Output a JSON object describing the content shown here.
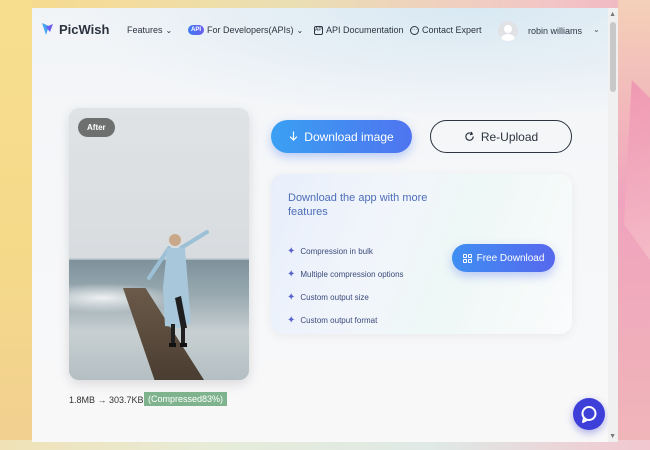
{
  "nav": {
    "logo_text": "PicWish",
    "features_label": "Features",
    "api_badge": "API",
    "developers_label": "For Developers(APIs)",
    "api_docs_icon_text": "API",
    "api_docs_label": "API Documentation",
    "contact_label": "Contact Expert",
    "user_name": "robin williams"
  },
  "preview": {
    "badge": "After"
  },
  "result": {
    "size_text": "1.8MB → 303.7KB",
    "compressed_badge": "(Compressed83%)"
  },
  "actions": {
    "download_label": "Download image",
    "reupload_label": "Re-Upload"
  },
  "promo": {
    "title": "Download the app with more features",
    "features": [
      "Compression in bulk",
      "Multiple compression options",
      "Custom output size",
      "Custom output format"
    ],
    "free_download_label": "Free Download"
  },
  "colors": {
    "accent_blue": "#4f74f0",
    "promo_title": "#4e6db8",
    "compressed_badge": "#7fb38d",
    "chat_button": "#3d3fd8"
  }
}
